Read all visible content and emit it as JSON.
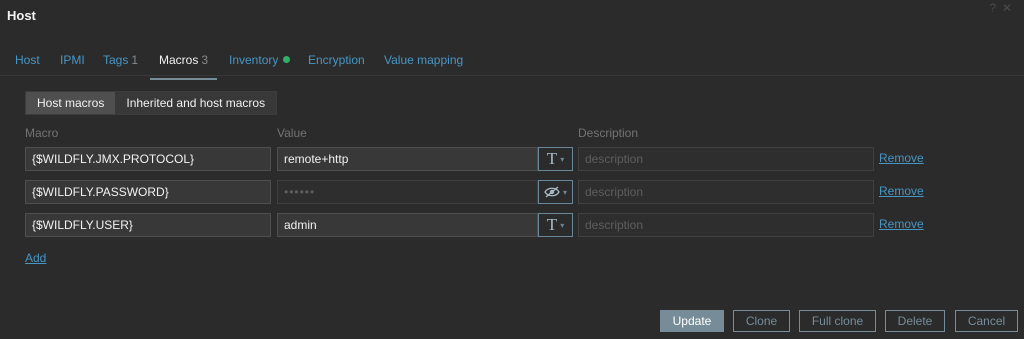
{
  "window": {
    "title": "Host",
    "help_icon": "?",
    "close_icon": "✕"
  },
  "tabs": [
    {
      "label": "Host",
      "count": ""
    },
    {
      "label": "IPMI",
      "count": ""
    },
    {
      "label": "Tags",
      "count": "1"
    },
    {
      "label": "Macros",
      "count": "3"
    },
    {
      "label": "Inventory",
      "count": ""
    },
    {
      "label": "Encryption",
      "count": ""
    },
    {
      "label": "Value mapping",
      "count": ""
    }
  ],
  "active_tab": "Macros",
  "inventory_status_color": "#34af67",
  "macro_view": {
    "options": [
      "Host macros",
      "Inherited and host macros"
    ],
    "selected": "Host macros"
  },
  "columns": {
    "macro": "Macro",
    "value": "Value",
    "description": "Description"
  },
  "macros": [
    {
      "macro": "{$WILDFLY.JMX.PROTOCOL}",
      "value": "remote+http",
      "type": "text",
      "type_icon": "T",
      "description_placeholder": "description",
      "remove": "Remove"
    },
    {
      "macro": "{$WILDFLY.PASSWORD}",
      "value": "••••••",
      "type": "secret",
      "type_icon": "eye-slash-icon",
      "description_placeholder": "description",
      "remove": "Remove"
    },
    {
      "macro": "{$WILDFLY.USER}",
      "value": "admin",
      "type": "text",
      "type_icon": "T",
      "description_placeholder": "description",
      "remove": "Remove"
    }
  ],
  "add_label": "Add",
  "buttons": {
    "update": "Update",
    "clone": "Clone",
    "full_clone": "Full clone",
    "delete": "Delete",
    "cancel": "Cancel"
  },
  "colors": {
    "background": "#2b2b2b",
    "link": "#4796c4",
    "accent": "#768d99"
  }
}
